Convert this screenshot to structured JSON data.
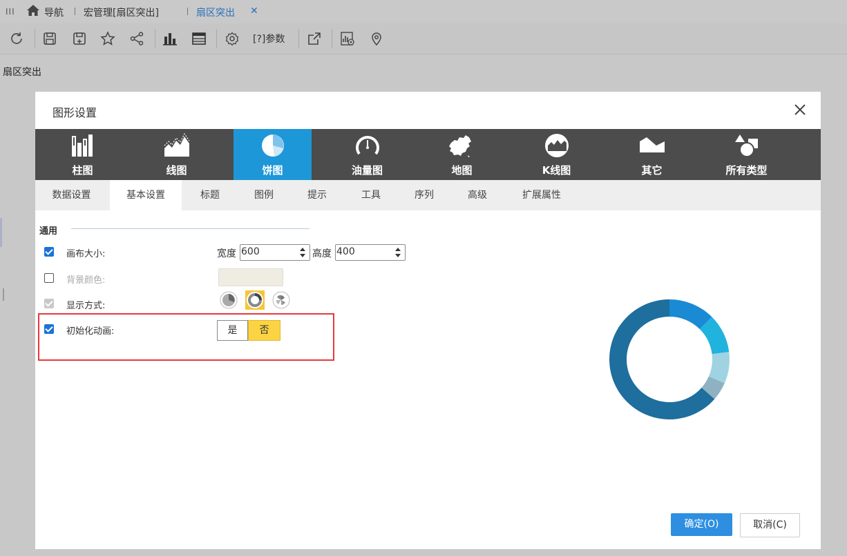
{
  "topbar": {
    "menu_glyph": "III",
    "home_label": "导航",
    "tab1_label": "宏管理[扇区突出]",
    "tab2_label": "扇区突出",
    "tab2_close": "✕"
  },
  "toolbar": {
    "items": [
      "refresh-icon",
      "save-icon",
      "save-as-icon",
      "star-icon",
      "share-icon",
      "bar-chart-icon",
      "table-icon",
      "settings-icon"
    ],
    "params_label": "[?]参数",
    "extra_icons": [
      "export-icon",
      "chart-settings-icon",
      "location-icon"
    ]
  },
  "page": {
    "title": "扇区突出"
  },
  "dialog": {
    "title": "图形设置",
    "chart_types": [
      {
        "label": "柱图",
        "icon": "bar-chart-icon"
      },
      {
        "label": "线图",
        "icon": "line-chart-icon"
      },
      {
        "label": "饼图",
        "icon": "pie-chart-icon",
        "active": true
      },
      {
        "label": "油量图",
        "icon": "gauge-icon"
      },
      {
        "label": "地图",
        "icon": "map-icon"
      },
      {
        "label": "K线图",
        "icon": "kline-chart-icon"
      },
      {
        "label": "其它",
        "icon": "other-chart-icon"
      },
      {
        "label": "所有类型",
        "icon": "all-types-icon"
      }
    ],
    "subtabs": [
      "数据设置",
      "基本设置",
      "标题",
      "图例",
      "提示",
      "工具",
      "序列",
      "高级",
      "扩展属性"
    ],
    "active_subtab": "基本设置",
    "section_label": "通用",
    "rows": {
      "canvas_size": {
        "label": "画布大小:",
        "checked": true,
        "width_label": "宽度",
        "width_value": "600",
        "height_label": "高度",
        "height_value": "400"
      },
      "bg_color": {
        "label": "背景颜色:",
        "checked": false
      },
      "display_mode": {
        "label": "显示方式:",
        "checked": true,
        "disabled": true
      },
      "init_anim": {
        "label": "初始化动画:",
        "checked": true,
        "yes_label": "是",
        "no_label": "否",
        "selected": "否"
      }
    },
    "ok_label": "确定(O)",
    "cancel_label": "取消(C)"
  },
  "chart_data": {
    "type": "pie",
    "donut": true,
    "values": [
      12.5,
      10.5,
      8.5,
      5,
      63.5
    ],
    "colors": [
      "#1a8ad4",
      "#1fb3de",
      "#9fd3e2",
      "#8fb2c2",
      "#1e6e9e"
    ]
  }
}
